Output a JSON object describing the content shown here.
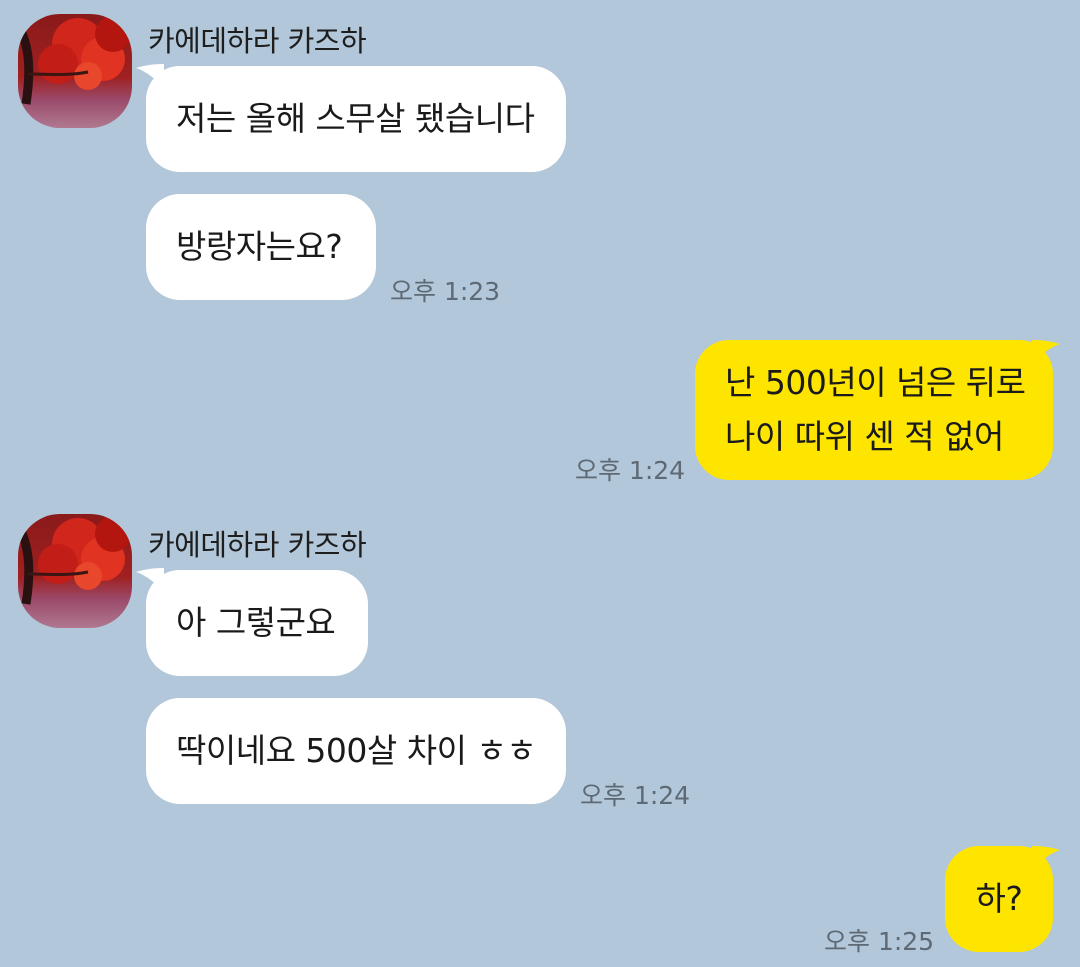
{
  "contact": {
    "name": "카에데하라 카즈하"
  },
  "messages": {
    "g1": {
      "name": "카에데하라 카즈하",
      "m1": "저는 올해 스무살 됐습니다",
      "m2": "방랑자는요?",
      "time": "오후 1:23"
    },
    "o1": {
      "line1": "난 500년이 넘은 뒤로",
      "line2": "나이 따위 센 적 없어",
      "time": "오후 1:24"
    },
    "g2": {
      "name": "카에데하라 카즈하",
      "m1": "아 그렇군요",
      "m2": "딱이네요 500살 차이 ㅎㅎ",
      "time": "오후 1:24"
    },
    "o2": {
      "text": "하?",
      "time": "오후 1:25"
    }
  },
  "colors": {
    "background": "#b2c7d9",
    "incoming_bubble": "#ffffff",
    "outgoing_bubble": "#fee500",
    "timestamp": "#5d6974"
  },
  "icons": {
    "avatar": "red-maple-leaves-profile"
  }
}
